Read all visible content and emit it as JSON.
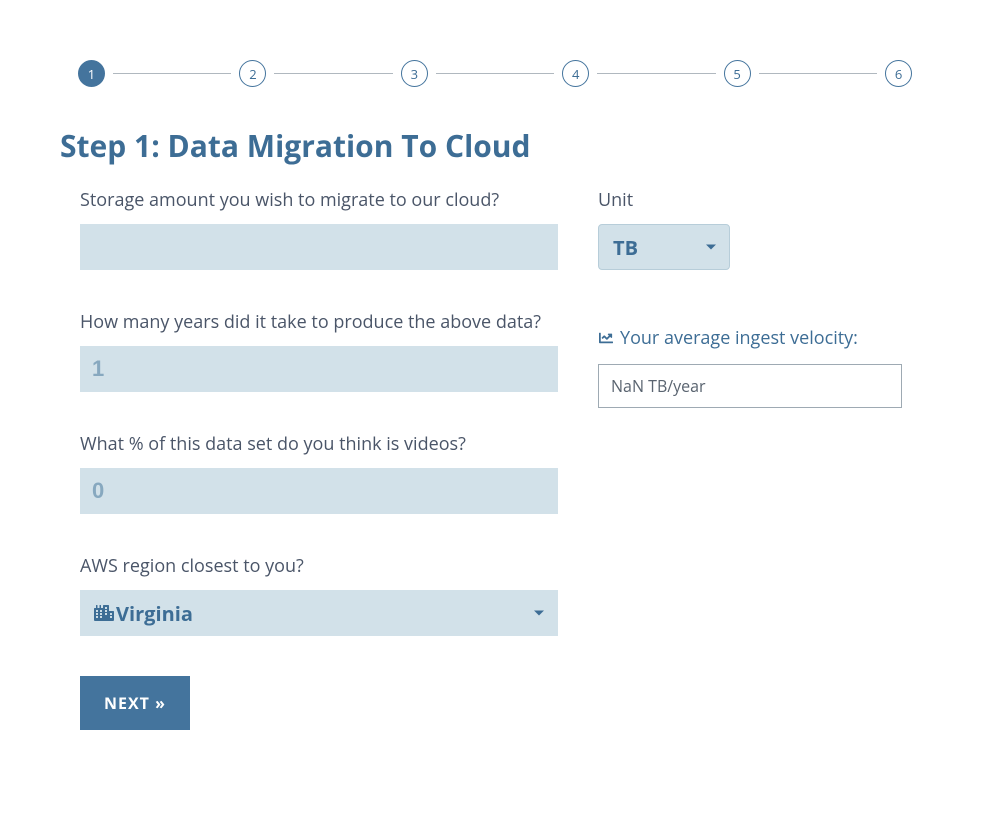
{
  "stepper": {
    "steps": [
      "1",
      "2",
      "3",
      "4",
      "5",
      "6"
    ],
    "active_index": 0
  },
  "title": "Step 1: Data Migration To Cloud",
  "fields": {
    "storage_label": "Storage amount you wish to migrate to our cloud?",
    "storage_value": "",
    "unit_label": "Unit",
    "unit_value": "TB",
    "years_label": "How many years did it take to produce the above data?",
    "years_placeholder": "1",
    "years_value": "",
    "videos_label": "What % of this data set do you think is videos?",
    "videos_placeholder": "0",
    "videos_value": "",
    "region_label": "AWS region closest to you?",
    "region_value": "Virginia"
  },
  "velocity": {
    "label": "Your average ingest velocity:",
    "value": "NaN  TB/year"
  },
  "buttons": {
    "next": "NEXT »"
  },
  "colors": {
    "primary": "#44749d",
    "input_bg": "#d2e1e9",
    "text_dark": "#3d6d95"
  }
}
